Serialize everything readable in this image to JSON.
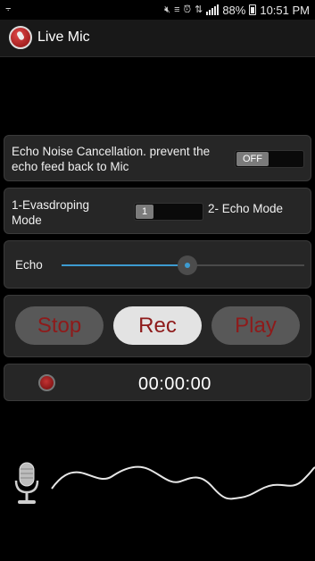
{
  "status_bar": {
    "carrier_icon": "⨪",
    "battery_percent": "88%",
    "time": "10:51 PM",
    "icons": [
      "mute-icon",
      "nfc-icon",
      "alarm-icon",
      "data-icon",
      "signal-icon"
    ]
  },
  "app_bar": {
    "title": "Live Mic",
    "logo_icon": "mic-logo-icon"
  },
  "echo_cancellation": {
    "label": "Echo Noise Cancellation. prevent the echo feed back to Mic",
    "toggle_state": "OFF"
  },
  "mode_switch": {
    "left_label": "1-Evasdroping Mode",
    "value": "1",
    "right_label": "2- Echo Mode"
  },
  "echo_slider": {
    "label": "Echo",
    "level": 0.52,
    "accent_color": "#3d9bd0"
  },
  "controls": {
    "stop_label": "Stop",
    "rec_label": "Rec",
    "play_label": "Play",
    "label_color": "#8e1a1a"
  },
  "recording": {
    "timer": "00:00:00",
    "indicator_icon": "record-dot-icon"
  },
  "waveform": {
    "mic_icon": "microphone-icon"
  }
}
